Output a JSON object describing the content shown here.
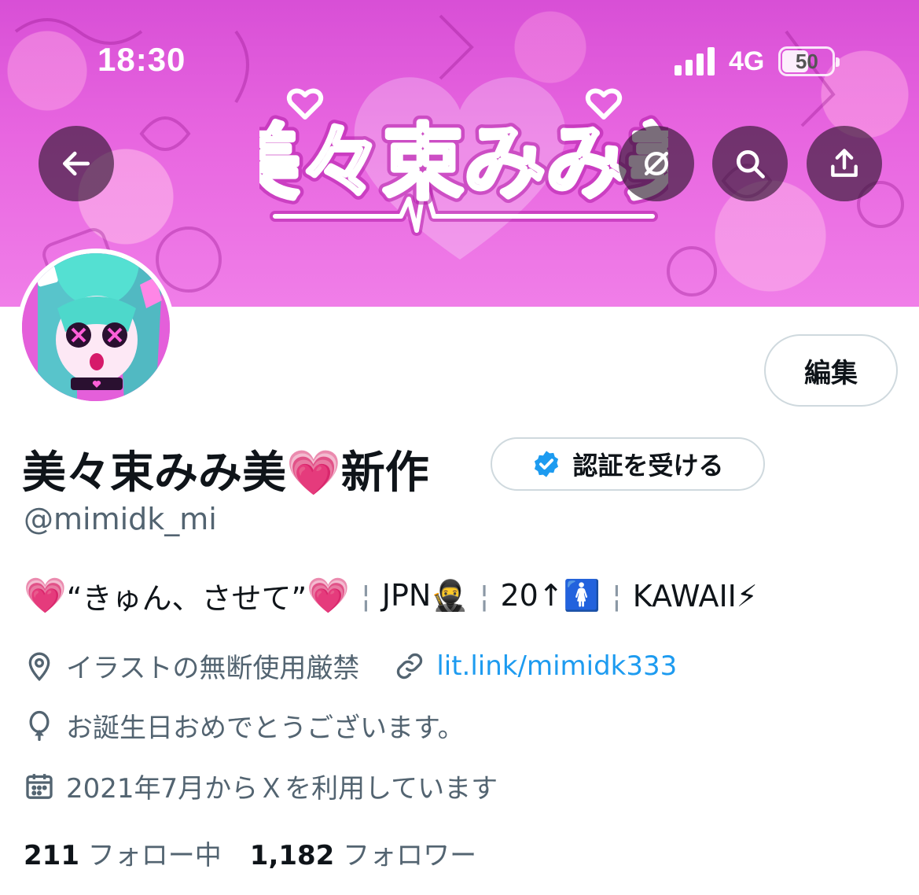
{
  "status_bar": {
    "time": "18:30",
    "network": "4G",
    "battery": "50",
    "battery_level": 0.5
  },
  "banner": {
    "logo_text": "美々束みみ美",
    "colors": {
      "primary": "#e866e0",
      "logo_stroke": "#ffffff",
      "logo_glow": "#b21aa8"
    }
  },
  "toolbar": {
    "back_icon": "arrow-left-icon",
    "grok_icon": "grok-icon",
    "search_icon": "search-icon",
    "share_icon": "share-icon"
  },
  "profile": {
    "edit_label": "編集",
    "display_name": "美々束みみ美💗新作",
    "verify_label": "認証を受ける",
    "handle": "@mimidk_mi",
    "bio": {
      "heart_1": "💗",
      "quote": "“きゅん、させて”",
      "heart_2": "💗",
      "sep": "¦",
      "part_jpn": "JPN🥷",
      "part_age": "20↑🚺",
      "part_kawaii": "KAWAII⚡"
    },
    "location": "イラストの無断使用厳禁",
    "website": "lit.link/mimidk333",
    "birthday": "お誕生日おめでとうございます。",
    "joined": "2021年7月からＸを利用しています",
    "following_count": "211",
    "following_label": "フォロー中",
    "followers_count": "1,182",
    "followers_label": "フォロワー"
  },
  "colors": {
    "link": "#1d9bf0",
    "muted": "#536471",
    "verified": "#1d9bf0",
    "heart": "#ff1a9a"
  }
}
